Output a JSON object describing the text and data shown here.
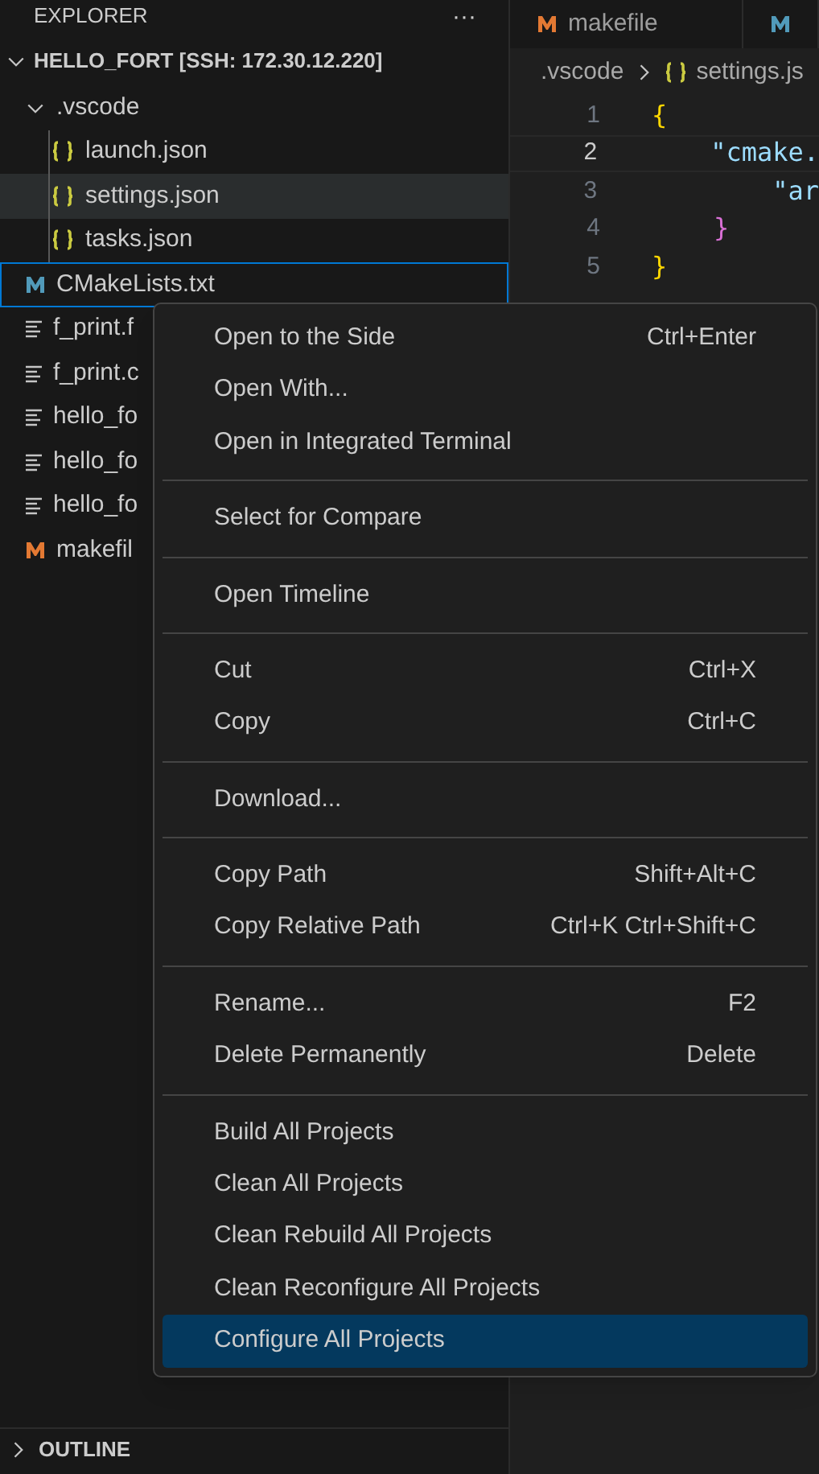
{
  "explorer": {
    "title": "EXPLORER",
    "more": "···",
    "root": {
      "label": "HELLO_FORT [SSH: 172.30.12.220]",
      "expanded": true,
      "children": [
        {
          "label": ".vscode",
          "kind": "folder",
          "expanded": true,
          "selected": false,
          "focused": false,
          "children": [
            {
              "label": "launch.json",
              "kind": "json",
              "selected": false,
              "focused": false
            },
            {
              "label": "settings.json",
              "kind": "json",
              "selected": true,
              "focused": false
            },
            {
              "label": "tasks.json",
              "kind": "json",
              "selected": false,
              "focused": false
            }
          ]
        },
        {
          "label": "CMakeLists.txt",
          "kind": "cmake",
          "selected": false,
          "focused": true
        },
        {
          "label": "f_print.f",
          "kind": "text",
          "selected": false,
          "focused": false
        },
        {
          "label": "f_print.c",
          "kind": "text",
          "selected": false,
          "focused": false
        },
        {
          "label": "hello_fo",
          "kind": "text",
          "selected": false,
          "focused": false
        },
        {
          "label": "hello_fo",
          "kind": "text",
          "selected": false,
          "focused": false
        },
        {
          "label": "hello_fo",
          "kind": "text",
          "selected": false,
          "focused": false
        },
        {
          "label": "makefil",
          "kind": "makefile",
          "selected": false,
          "focused": false
        }
      ]
    },
    "outline": {
      "label": "OUTLINE",
      "expanded": false
    }
  },
  "tabs": [
    {
      "label": "makefile",
      "kind": "makefile"
    },
    {
      "kind": "cmake"
    }
  ],
  "breadcrumb": [
    {
      "label": ".vscode",
      "kind": "folder"
    },
    {
      "label": "settings.js",
      "kind": "json"
    }
  ],
  "code": [
    {
      "number": "1",
      "current": false,
      "text": "{",
      "color": "#ffd700"
    },
    {
      "number": "2",
      "current": true,
      "text": "    \"cmake.",
      "color": "#9cdcfe"
    },
    {
      "number": "3",
      "current": false,
      "text": "        \"ar",
      "color": "#9cdcfe"
    },
    {
      "number": "4",
      "current": false,
      "text": "    }",
      "color": "#da70d6"
    },
    {
      "number": "5",
      "current": false,
      "text": "}",
      "color": "#ffd700"
    }
  ],
  "context_menu": [
    [
      {
        "label": "Open to the Side",
        "shortcut": "Ctrl+Enter",
        "selected": false
      },
      {
        "label": "Open With...",
        "selected": false
      },
      {
        "label": "Open in Integrated Terminal",
        "selected": false
      }
    ],
    [
      {
        "label": "Select for Compare",
        "selected": false
      }
    ],
    [
      {
        "label": "Open Timeline",
        "selected": false
      }
    ],
    [
      {
        "label": "Cut",
        "shortcut": "Ctrl+X",
        "selected": false
      },
      {
        "label": "Copy",
        "shortcut": "Ctrl+C",
        "selected": false
      }
    ],
    [
      {
        "label": "Download...",
        "selected": false
      }
    ],
    [
      {
        "label": "Copy Path",
        "shortcut": "Shift+Alt+C",
        "selected": false
      },
      {
        "label": "Copy Relative Path",
        "shortcut": "Ctrl+K Ctrl+Shift+C",
        "selected": false
      }
    ],
    [
      {
        "label": "Rename...",
        "shortcut": "F2",
        "selected": false
      },
      {
        "label": "Delete Permanently",
        "shortcut": "Delete",
        "selected": false
      }
    ],
    [
      {
        "label": "Build All Projects",
        "selected": false
      },
      {
        "label": "Clean All Projects",
        "selected": false
      },
      {
        "label": "Clean Rebuild All Projects",
        "selected": false
      },
      {
        "label": "Clean Reconfigure All Projects",
        "selected": false
      },
      {
        "label": "Configure All Projects",
        "selected": true
      }
    ]
  ]
}
